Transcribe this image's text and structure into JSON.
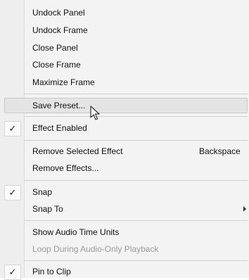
{
  "menu": {
    "items": [
      {
        "label": "Undock Panel"
      },
      {
        "label": "Undock Frame"
      },
      {
        "label": "Close Panel"
      },
      {
        "label": "Close Frame"
      },
      {
        "label": "Maximize Frame"
      },
      {
        "label": "Save Preset..."
      },
      {
        "label": "Effect Enabled",
        "checked": true,
        "check_glyph": "✓"
      },
      {
        "label": "Remove Selected Effect",
        "shortcut": "Backspace"
      },
      {
        "label": "Remove Effects..."
      },
      {
        "label": "Snap",
        "checked": true,
        "check_glyph": "✓"
      },
      {
        "label": "Snap To",
        "submenu": true
      },
      {
        "label": "Show Audio Time Units"
      },
      {
        "label": "Loop During Audio-Only Playback",
        "disabled": true
      },
      {
        "label": "Pin to Clip",
        "checked": true,
        "check_glyph": "✓"
      }
    ]
  }
}
